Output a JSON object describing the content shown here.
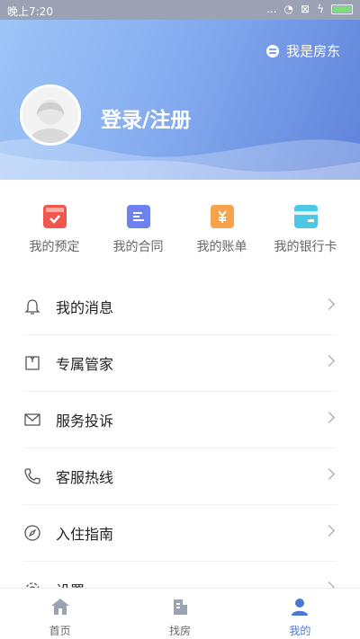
{
  "status": {
    "time": "晚上7:20",
    "signal": "..."
  },
  "header": {
    "landlord_label": "我是房东",
    "login_label": "登录/注册"
  },
  "quick_actions": [
    {
      "label": "我的预定",
      "icon": "calendar-check-icon",
      "color": "#f0584f"
    },
    {
      "label": "我的合同",
      "icon": "contract-icon",
      "color": "#6d82ef"
    },
    {
      "label": "我的账单",
      "icon": "bill-icon",
      "color": "#f7a24c"
    },
    {
      "label": "我的银行卡",
      "icon": "bank-card-icon",
      "color": "#4cc8e4"
    }
  ],
  "menu": [
    {
      "label": "我的消息",
      "icon": "bell-icon"
    },
    {
      "label": "专属管家",
      "icon": "shirt-icon"
    },
    {
      "label": "服务投诉",
      "icon": "mail-icon"
    },
    {
      "label": "客服热线",
      "icon": "phone-icon"
    },
    {
      "label": "入住指南",
      "icon": "compass-icon"
    },
    {
      "label": "设置",
      "icon": "gear-icon"
    }
  ],
  "tabbar": [
    {
      "label": "首页",
      "icon": "home-icon"
    },
    {
      "label": "找房",
      "icon": "building-icon"
    },
    {
      "label": "我的",
      "icon": "user-icon"
    }
  ],
  "colors": {
    "accent": "#4a78d6",
    "inactive": "#9aa3b2"
  }
}
